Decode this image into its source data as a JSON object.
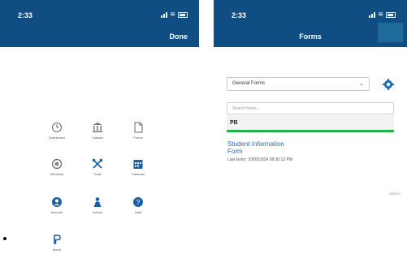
{
  "left_screen": {
    "time": "2:33",
    "done_label": "Done",
    "grid_items": [
      {
        "label": "Dashboard",
        "icon": "clock-icon"
      },
      {
        "label": "Classes",
        "icon": "bank-icon"
      },
      {
        "label": "Forms",
        "icon": "document-icon"
      },
      {
        "label": "Windows",
        "icon": "gauge-icon"
      },
      {
        "label": "Tools",
        "icon": "tools-icon"
      },
      {
        "label": "Calendar",
        "icon": "calendar-icon"
      },
      {
        "label": "Account",
        "icon": "account-icon"
      },
      {
        "label": "School",
        "icon": "person-icon"
      },
      {
        "label": "Help",
        "icon": "help-icon"
      },
      {
        "label": "About",
        "icon": "about-icon"
      }
    ]
  },
  "right_screen": {
    "time": "2:33",
    "title": "Forms",
    "dropdown_value": "General Forms",
    "search_placeholder": "Search forms...",
    "section_title": "PB",
    "form_link": "Student Information Form",
    "form_link_line1": "Student Information",
    "form_link_line2": "Form",
    "last_entry": "Last Entry: 10/03/2024 08:30:12 PM",
    "version": "v2022.1"
  },
  "colors": {
    "header": "#0f4d83",
    "accent": "#2a6bb3",
    "green": "#21b24a"
  }
}
